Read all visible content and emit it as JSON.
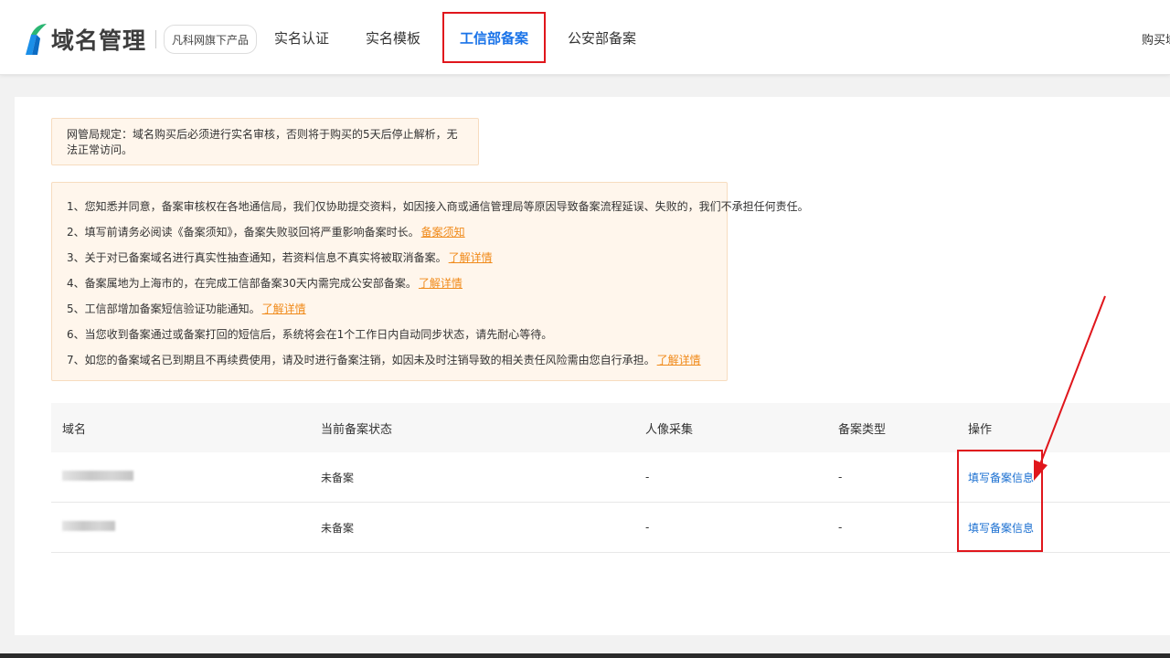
{
  "header": {
    "logo_text": "域名管理",
    "sub_badge": "凡科网旗下产品",
    "nav": [
      {
        "label": "实名认证"
      },
      {
        "label": "实名模板"
      },
      {
        "label": "工信部备案",
        "active": true
      },
      {
        "label": "公安部备案"
      }
    ],
    "right_link": "购买域"
  },
  "notice": {
    "top": "网管局规定：域名购买后必须进行实名审核，否则将于购买的5天后停止解析，无法正常访问。",
    "items": [
      {
        "text": "1、您知悉并同意，备案审核权在各地通信局，我们仅协助提交资料，如因接入商或通信管理局等原因导致备案流程延误、失败的，我们不承担任何责任。",
        "link": ""
      },
      {
        "text": "2、填写前请务必阅读《备案须知》，备案失败驳回将严重影响备案时长。",
        "link": "备案须知"
      },
      {
        "text": "3、关于对已备案域名进行真实性抽查通知，若资料信息不真实将被取消备案。",
        "link": "了解详情"
      },
      {
        "text": "4、备案属地为上海市的，在完成工信部备案30天内需完成公安部备案。",
        "link": "了解详情"
      },
      {
        "text": "5、工信部增加备案短信验证功能通知。",
        "link": "了解详情"
      },
      {
        "text": "6、当您收到备案通过或备案打回的短信后，系统将会在1个工作日内自动同步状态，请先耐心等待。",
        "link": ""
      },
      {
        "text": "7、如您的备案域名已到期且不再续费使用，请及时进行备案注销，如因未及时注销导致的相关责任风险需由您自行承担。",
        "link": "了解详情"
      }
    ]
  },
  "table": {
    "headers": [
      "域名",
      "当前备案状态",
      "人像采集",
      "备案类型",
      "操作"
    ],
    "rows": [
      {
        "status": "未备案",
        "portrait": "-",
        "type": "-",
        "action": "填写备案信息"
      },
      {
        "status": "未备案",
        "portrait": "-",
        "type": "-",
        "action": "填写备案信息"
      }
    ]
  },
  "colors": {
    "accent": "#1a73e8",
    "highlight": "#e0161c",
    "notice_bg": "#fff6ec",
    "link_orange": "#f08a1a"
  }
}
